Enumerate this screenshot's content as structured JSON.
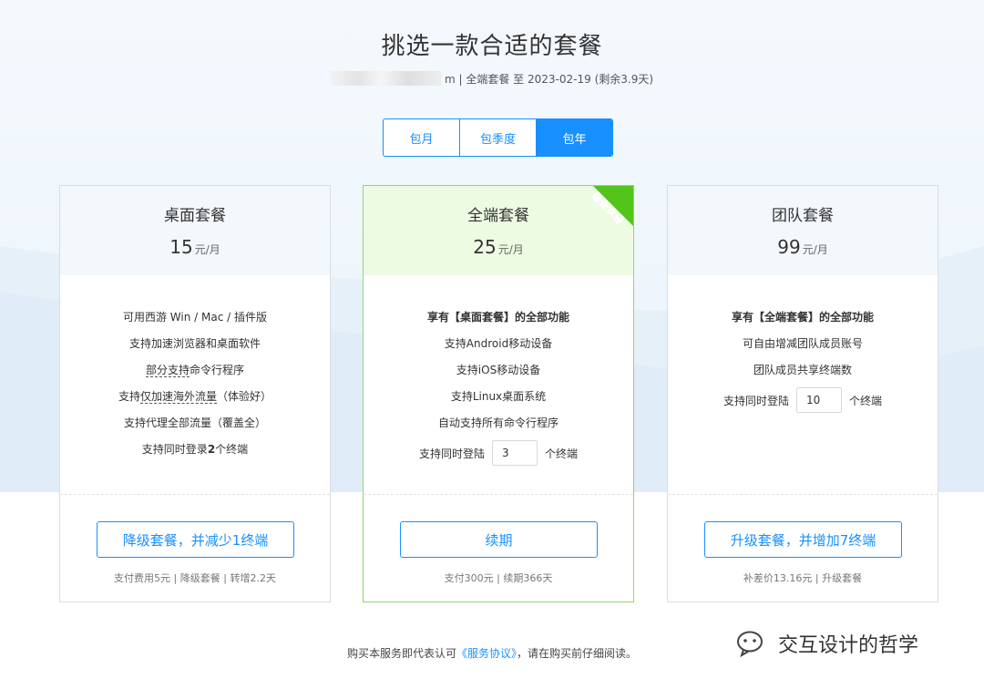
{
  "header": {
    "title": "挑选一款合适的套餐",
    "account_suffix": "m",
    "current_plan": "全端套餐",
    "expiry_prefix": "至",
    "expiry_date": "2023-02-19",
    "remaining": "(剩余3.9天)"
  },
  "tabs": [
    {
      "label": "包月"
    },
    {
      "label": "包季度"
    },
    {
      "label": "包年",
      "active": true
    }
  ],
  "plans": [
    {
      "name": "桌面套餐",
      "price": "15",
      "unit": "元/月",
      "features": [
        "可用西游 Win / Mac / 插件版",
        "支持加速浏览器和桌面软件"
      ],
      "feature_partial_dash": "部分支持",
      "feature_partial_rest": "命令行程序",
      "feature_overseas_pre": "支持",
      "feature_overseas_dash": "仅加速海外流量",
      "feature_overseas_post": "（体验好）",
      "feature_proxy": "支持代理全部流量（覆盖全）",
      "login_pre": "支持同时登录",
      "login_count": "2",
      "login_post": "个终端",
      "button": "降级套餐，并减少1终端",
      "note": "支付费用5元 | 降级套餐 | 转增2.2天"
    },
    {
      "name": "全端套餐",
      "price": "25",
      "unit": "元/月",
      "ribbon": "最受欢迎",
      "features_bold": [
        "享有【桌面套餐】的全部功能"
      ],
      "features": [
        "支持Android移动设备",
        "支持iOS移动设备",
        "支持Linux桌面系统",
        "自动支持所有命令行程序"
      ],
      "seat_label": "支持同时登陆",
      "seat_value": "3",
      "seat_unit": "个终端",
      "button": "续期",
      "note": "支付300元 | 续期366天"
    },
    {
      "name": "团队套餐",
      "price": "99",
      "unit": "元/月",
      "features_bold": [
        "享有【全端套餐】的全部功能"
      ],
      "features": [
        "可自由增减团队成员账号",
        "团队成员共享终端数"
      ],
      "seat_label": "支持同时登陆",
      "seat_value": "10",
      "seat_unit": "个终端",
      "button": "升级套餐，并增加7终端",
      "note": "补差价13.16元 | 升级套餐"
    }
  ],
  "footer": {
    "prefix": "购买本服务即代表认可",
    "link": "《服务协议》",
    "suffix": "，请在购买前仔细阅读。"
  },
  "watermark": "交互设计的哲学",
  "colors": {
    "accent": "#1890ff",
    "popular_border": "#8fdb6a",
    "ribbon": "#52c41a"
  }
}
